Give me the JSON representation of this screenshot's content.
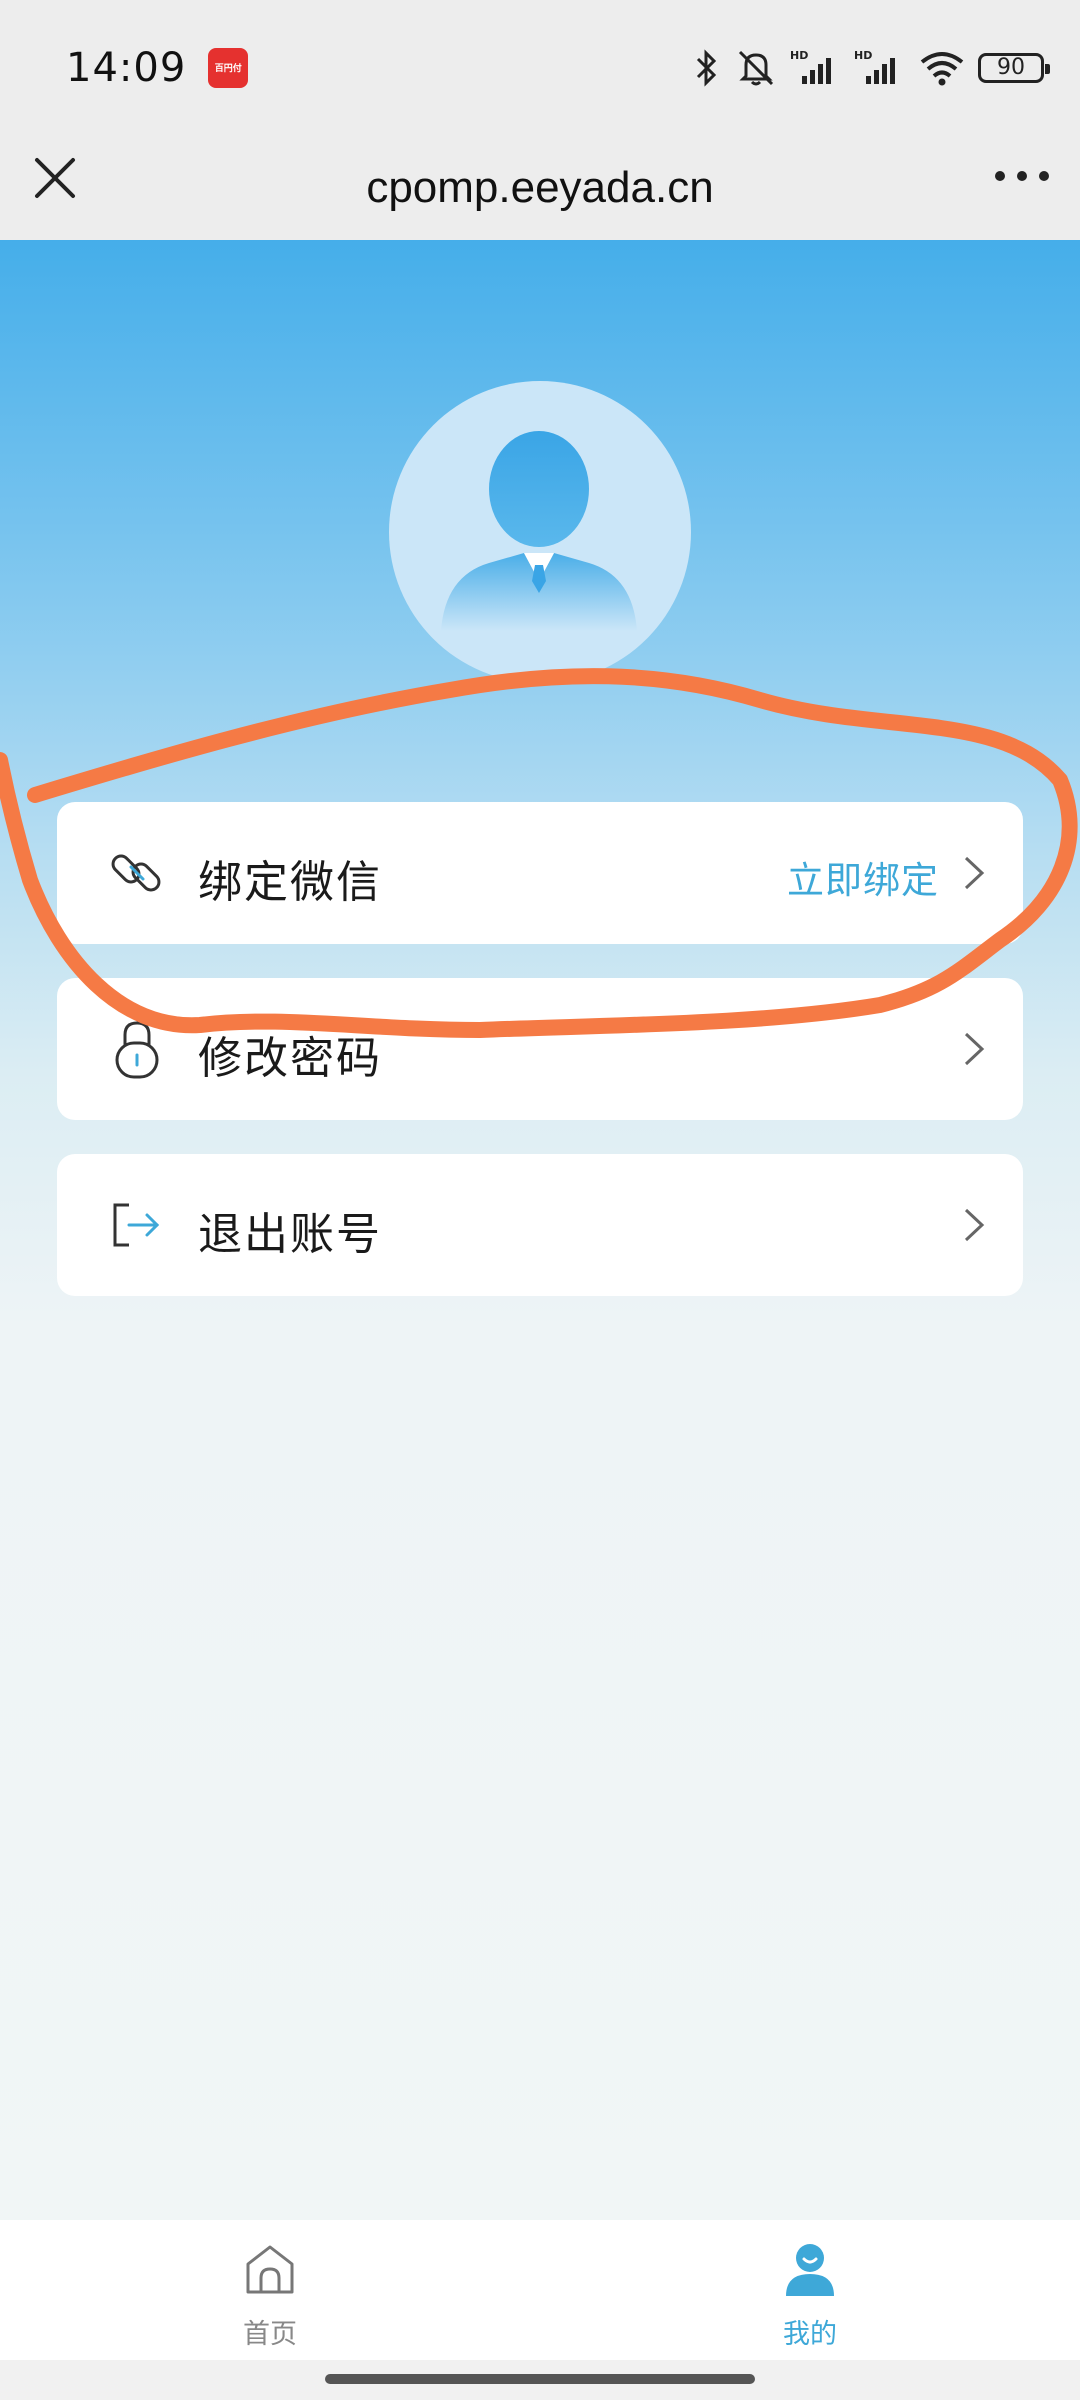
{
  "status_bar": {
    "time": "14:09",
    "app_badge_text": "百円付",
    "battery_level": "90",
    "icons": [
      "bluetooth-icon",
      "mute-bell-icon",
      "signal-hd-icon",
      "signal-hd-icon",
      "wifi-icon",
      "battery-icon"
    ],
    "network_label": "HD"
  },
  "browser": {
    "url": "cpomp.eeyada.cn",
    "close_icon": "close-icon",
    "more_icon": "more-icon"
  },
  "profile": {
    "avatar_icon": "user-avatar-icon"
  },
  "menu": [
    {
      "label": "绑定微信",
      "action": "立即绑定",
      "icon": "link-icon"
    },
    {
      "label": "修改密码",
      "action": "",
      "icon": "lock-icon"
    },
    {
      "label": "退出账号",
      "action": "",
      "icon": "logout-icon"
    }
  ],
  "bottom_nav": {
    "items": [
      {
        "label": "首页",
        "icon": "home-icon",
        "active": false
      },
      {
        "label": "我的",
        "icon": "profile-icon",
        "active": true
      }
    ]
  },
  "colors": {
    "accent": "#3ea8d8",
    "header_blue": "#45aeea",
    "annotation": "#f57a45"
  }
}
